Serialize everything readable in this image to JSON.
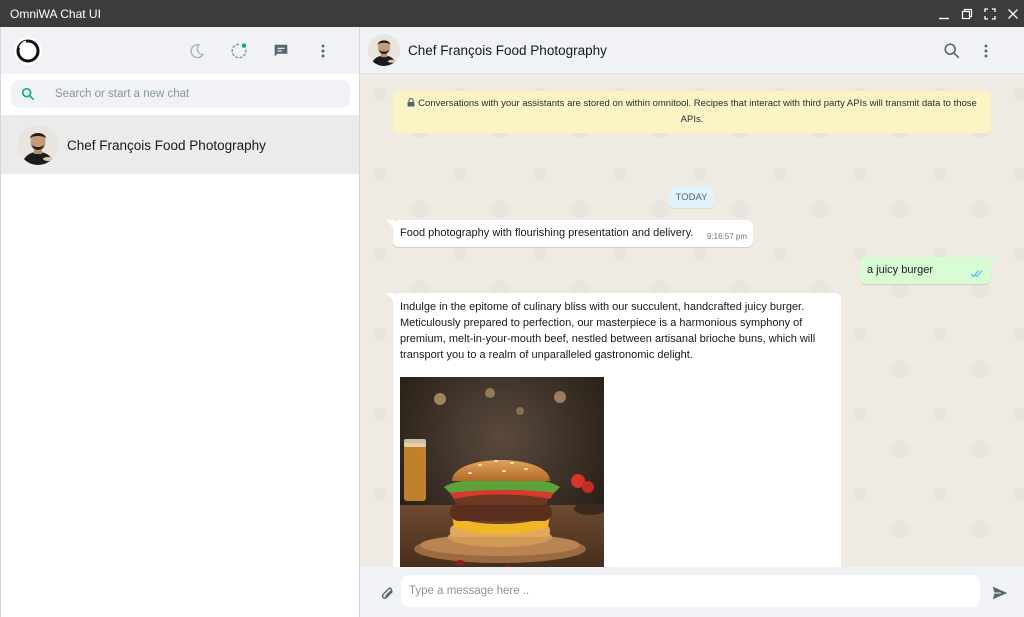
{
  "window": {
    "title": "OmniWA Chat UI"
  },
  "sidebar": {
    "search_placeholder": "Search or start a new chat",
    "chats": [
      {
        "name": "Chef François Food Photography"
      }
    ]
  },
  "conversation": {
    "contact_name": "Chef François Food Photography",
    "notice": "Conversations with your assistants are stored on within omnitool. Recipes that interact with third party APIs will transmit data to those APIs.",
    "date_label": "TODAY",
    "messages": [
      {
        "direction": "incoming",
        "text": "Food photography with flourishing presentation and delivery.",
        "time": "9:16:57 pm"
      },
      {
        "direction": "outgoing",
        "text": "a juicy burger",
        "status": "read"
      },
      {
        "direction": "incoming",
        "text": "Indulge in the epitome of culinary bliss with our succulent, handcrafted juicy burger. Meticulously prepared to perfection, our masterpiece is a harmonious symphony of premium, melt-in-your-mouth beef, nestled between artisanal brioche buns, which will transport you to a realm of unparalleled gastronomic delight.",
        "image": "juicy-burger-photo"
      }
    ],
    "composer_placeholder": "Type a message here .."
  },
  "colors": {
    "titlebar": "#3c3c3c",
    "panel_header": "#f0f2f5",
    "chat_background": "#efeae2",
    "incoming_bubble": "#ffffff",
    "outgoing_bubble": "#d9fdd3",
    "notice": "#fdf4c5",
    "accent": "#00a884",
    "read_ticks": "#53bdeb"
  },
  "icons": {
    "title_controls": [
      "minimize-icon",
      "restore-icon",
      "fullscreen-icon",
      "close-icon"
    ],
    "sidebar_header": [
      "app-logo-icon",
      "moon-icon",
      "status-icon",
      "new-chat-icon",
      "menu-dots-icon"
    ],
    "conversation_header": [
      "search-icon",
      "menu-dots-icon"
    ],
    "composer": [
      "paperclip-icon",
      "send-icon"
    ]
  }
}
